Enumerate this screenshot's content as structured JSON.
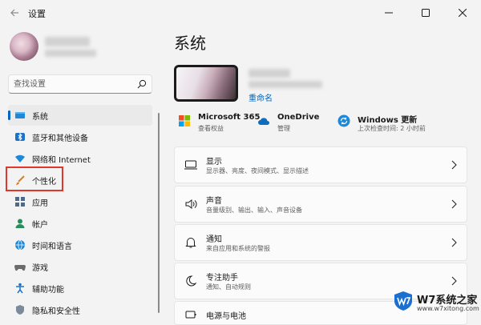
{
  "window": {
    "title": "设置"
  },
  "search": {
    "placeholder": "查找设置"
  },
  "nav": {
    "items": [
      {
        "label": "系统",
        "icon": "system-icon",
        "selected": true
      },
      {
        "label": "蓝牙和其他设备",
        "icon": "bluetooth-icon"
      },
      {
        "label": "网络和 Internet",
        "icon": "network-icon"
      },
      {
        "label": "个性化",
        "icon": "brush-icon",
        "highlighted": true
      },
      {
        "label": "应用",
        "icon": "apps-icon"
      },
      {
        "label": "帐户",
        "icon": "account-icon"
      },
      {
        "label": "时间和语言",
        "icon": "globe-icon"
      },
      {
        "label": "游戏",
        "icon": "game-icon"
      },
      {
        "label": "辅助功能",
        "icon": "accessibility-icon"
      },
      {
        "label": "隐私和安全性",
        "icon": "shield-icon"
      }
    ]
  },
  "main": {
    "title": "系统",
    "rename_label": "重命名",
    "services": [
      {
        "name": "Microsoft 365",
        "sub": "查看权益",
        "icon": "microsoft-logo-icon"
      },
      {
        "name": "OneDrive",
        "sub": "管理",
        "icon": "cloud-icon"
      },
      {
        "name": "Windows 更新",
        "sub": "上次检查时间: 2 小时前",
        "icon": "update-icon"
      }
    ],
    "cards": [
      {
        "title": "显示",
        "sub": "显示器、亮度、夜间模式、显示描述",
        "icon": "monitor-icon"
      },
      {
        "title": "声音",
        "sub": "音量级别、输出、输入、声音设备",
        "icon": "speaker-icon"
      },
      {
        "title": "通知",
        "sub": "来自应用和系统的警报",
        "icon": "bell-icon"
      },
      {
        "title": "专注助手",
        "sub": "通知、自动规则",
        "icon": "moon-icon"
      },
      {
        "title": "电源与电池",
        "sub": "",
        "icon": "power-icon"
      }
    ]
  },
  "watermark": {
    "text": "W7系统之家",
    "url": "www.w7xitong.com"
  },
  "colors": {
    "accent": "#0067c0",
    "highlight": "#e0362c",
    "background": "#f3f3f3"
  }
}
